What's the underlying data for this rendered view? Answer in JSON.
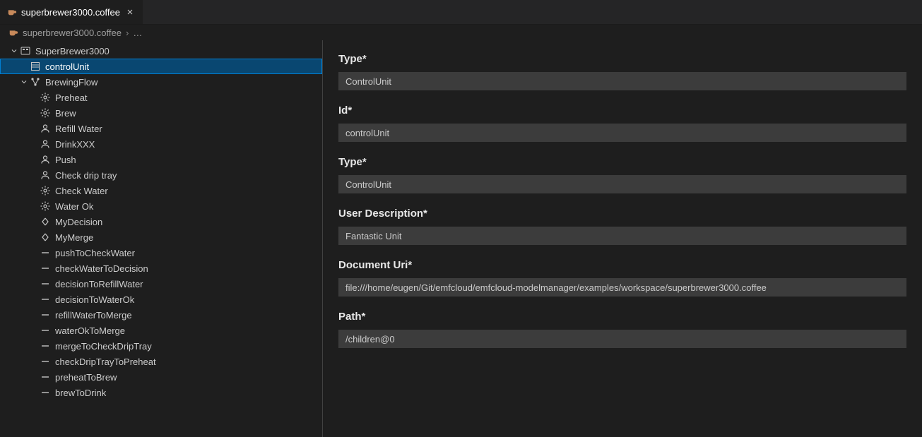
{
  "tab": {
    "label": "superbrewer3000.coffee"
  },
  "breadcrumb": {
    "label": "superbrewer3000.coffee",
    "separator": "›",
    "ellipsis": "…"
  },
  "tree": [
    {
      "id": "root",
      "depth": 0,
      "arrow": "down",
      "icon": "machine",
      "label": "SuperBrewer3000",
      "selected": false
    },
    {
      "id": "controlUnit",
      "depth": 1,
      "arrow": "none",
      "icon": "unit",
      "label": "controlUnit",
      "selected": true
    },
    {
      "id": "brewingFlow",
      "depth": 1,
      "arrow": "down",
      "icon": "flow",
      "label": "BrewingFlow",
      "selected": false
    },
    {
      "id": "preheat",
      "depth": 2,
      "arrow": "none",
      "icon": "gear",
      "label": "Preheat",
      "selected": false
    },
    {
      "id": "brew",
      "depth": 2,
      "arrow": "none",
      "icon": "gear",
      "label": "Brew",
      "selected": false
    },
    {
      "id": "refillWater",
      "depth": 2,
      "arrow": "none",
      "icon": "user",
      "label": "Refill Water",
      "selected": false
    },
    {
      "id": "drinkxxx",
      "depth": 2,
      "arrow": "none",
      "icon": "user",
      "label": "DrinkXXX",
      "selected": false
    },
    {
      "id": "push",
      "depth": 2,
      "arrow": "none",
      "icon": "user",
      "label": "Push",
      "selected": false
    },
    {
      "id": "checkDripTray",
      "depth": 2,
      "arrow": "none",
      "icon": "user",
      "label": "Check drip tray",
      "selected": false
    },
    {
      "id": "checkWater",
      "depth": 2,
      "arrow": "none",
      "icon": "gear",
      "label": "Check Water",
      "selected": false
    },
    {
      "id": "waterOk",
      "depth": 2,
      "arrow": "none",
      "icon": "gear",
      "label": "Water Ok",
      "selected": false
    },
    {
      "id": "myDecision",
      "depth": 2,
      "arrow": "none",
      "icon": "decision",
      "label": "MyDecision",
      "selected": false
    },
    {
      "id": "myMerge",
      "depth": 2,
      "arrow": "none",
      "icon": "merge",
      "label": "MyMerge",
      "selected": false
    },
    {
      "id": "pushToCheckWater",
      "depth": 2,
      "arrow": "none",
      "icon": "edge",
      "label": "pushToCheckWater",
      "selected": false
    },
    {
      "id": "checkWaterToDecision",
      "depth": 2,
      "arrow": "none",
      "icon": "edge",
      "label": "checkWaterToDecision",
      "selected": false
    },
    {
      "id": "decisionToRefillWater",
      "depth": 2,
      "arrow": "none",
      "icon": "edge",
      "label": "decisionToRefillWater",
      "selected": false
    },
    {
      "id": "decisionToWaterOk",
      "depth": 2,
      "arrow": "none",
      "icon": "edge",
      "label": "decisionToWaterOk",
      "selected": false
    },
    {
      "id": "refillWaterToMerge",
      "depth": 2,
      "arrow": "none",
      "icon": "edge",
      "label": "refillWaterToMerge",
      "selected": false
    },
    {
      "id": "waterOkToMerge",
      "depth": 2,
      "arrow": "none",
      "icon": "edge",
      "label": "waterOkToMerge",
      "selected": false
    },
    {
      "id": "mergeToCheckDripTray",
      "depth": 2,
      "arrow": "none",
      "icon": "edge",
      "label": "mergeToCheckDripTray",
      "selected": false
    },
    {
      "id": "checkDripTrayToPreheat",
      "depth": 2,
      "arrow": "none",
      "icon": "edge",
      "label": "checkDripTrayToPreheat",
      "selected": false
    },
    {
      "id": "preheatToBrew",
      "depth": 2,
      "arrow": "none",
      "icon": "edge",
      "label": "preheatToBrew",
      "selected": false
    },
    {
      "id": "brewToDrink",
      "depth": 2,
      "arrow": "none",
      "icon": "edge",
      "label": "brewToDrink",
      "selected": false
    }
  ],
  "form": {
    "fields": [
      {
        "label": "Type*",
        "value": "ControlUnit",
        "name": "type-field-1"
      },
      {
        "label": "Id*",
        "value": "controlUnit",
        "name": "id-field"
      },
      {
        "label": "Type*",
        "value": "ControlUnit",
        "name": "type-field-2"
      },
      {
        "label": "User Description*",
        "value": "Fantastic Unit",
        "name": "user-description-field"
      },
      {
        "label": "Document Uri*",
        "value": "file:///home/eugen/Git/emfcloud/emfcloud-modelmanager/examples/workspace/superbrewer3000.coffee",
        "name": "document-uri-field"
      },
      {
        "label": "Path*",
        "value": "/children@0",
        "name": "path-field"
      }
    ]
  }
}
